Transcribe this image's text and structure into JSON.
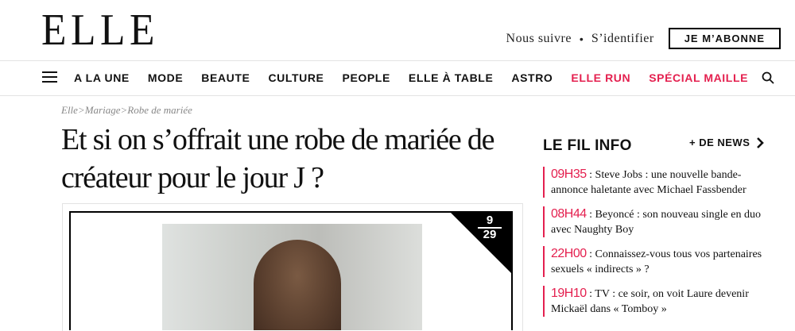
{
  "header": {
    "logo": "ELLE",
    "follow": "Nous suivre",
    "separator": "•",
    "login": "S’identifier",
    "subscribe": "JE M’ABONNE"
  },
  "nav": {
    "items": [
      {
        "label": "A LA UNE"
      },
      {
        "label": "MODE"
      },
      {
        "label": "BEAUTE"
      },
      {
        "label": "CULTURE"
      },
      {
        "label": "PEOPLE"
      },
      {
        "label": "ELLE À TABLE"
      },
      {
        "label": "ASTRO"
      },
      {
        "label": "ELLE RUN"
      },
      {
        "label": "SPÉCIAL MAILLE"
      }
    ],
    "accent_color": "#e4204f"
  },
  "breadcrumb": {
    "items": [
      "Elle",
      "Mariage",
      "Robe de mariée"
    ],
    "separator": ">"
  },
  "article": {
    "title": "Et si on s’offrait une robe de mariée de créateur pour le jour J ?",
    "gallery": {
      "current": "9",
      "total": "29"
    }
  },
  "fil_info": {
    "title": "LE FIL INFO",
    "more_label": "+ DE NEWS",
    "items": [
      {
        "time": "09H35",
        "text": " : Steve Jobs : une nouvelle bande-annonce haletante avec Michael Fassbender"
      },
      {
        "time": "08H44",
        "text": " : Beyoncé : son nouveau single en duo avec Naughty Boy"
      },
      {
        "time": "22H00",
        "text": " : Connaissez-vous tous vos partenaires sexuels « indirects » ?"
      },
      {
        "time": "19H10",
        "text": " : TV : ce soir, on voit Laure devenir Mickaël dans « Tomboy »"
      }
    ]
  },
  "icons": {
    "menu": "hamburger-menu-icon",
    "search": "search-icon",
    "more": "chevron-right-icon"
  }
}
